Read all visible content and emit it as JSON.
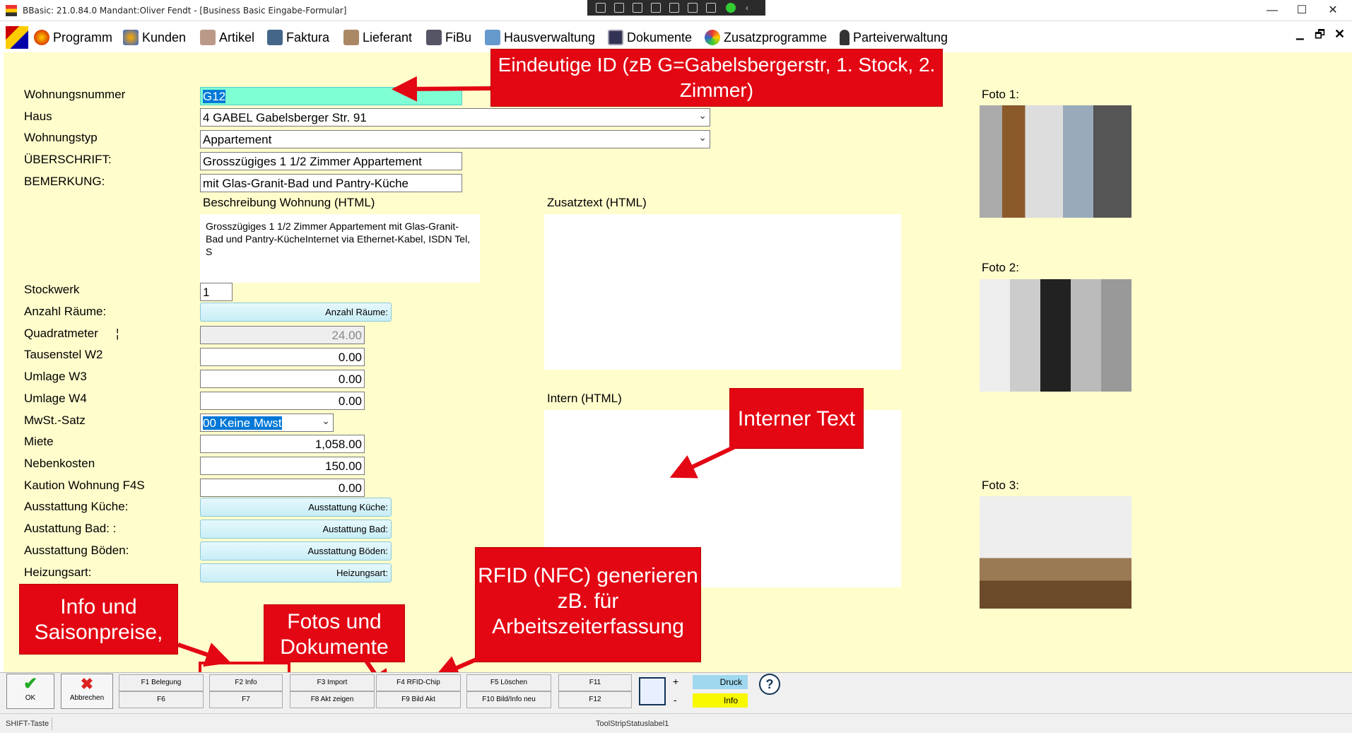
{
  "window": {
    "title": "BBasic: 21.0.84.0 Mandant:Oliver Fendt  - [Business Basic Eingabe-Formular]",
    "minimize": "—",
    "maximize": "☐",
    "close": "✕"
  },
  "menu": [
    "Programm",
    "Kunden",
    "Artikel",
    "Faktura",
    "Lieferant",
    "FiBu",
    "Hausverwaltung",
    "Dokumente",
    "Zusatzprogramme",
    "Parteiverwaltung"
  ],
  "mdi_controls": {
    "min": "▁",
    "restore": "🗗",
    "close": "✕"
  },
  "form": {
    "labels": {
      "wohnungsnummer": "Wohnungsnummer",
      "haus": "Haus",
      "wohnungstyp": "Wohnungstyp",
      "ueberschrift": "ÜBERSCHRIFT:",
      "bemerkung": "BEMERKUNG:",
      "stockwerk": "Stockwerk",
      "anzahl_raeume": "Anzahl Räume:",
      "quadratmeter": "Quadratmeter",
      "tausenstel": "Tausenstel W2",
      "umlage_w3": "Umlage W3",
      "umlage_w4": "Umlage W4",
      "mwst": "MwSt.-Satz",
      "miete": "Miete",
      "nebenkosten": "Nebenkosten",
      "kaution": "Kaution Wohnung F4S",
      "kueche": "Ausstattung Küche:",
      "bad": "Austattung Bad: :",
      "boeden": "Ausstattung Böden:",
      "heizung": "Heizungsart:"
    },
    "values": {
      "wohnungsnummer": "G12",
      "haus": "4 GABEL Gabelsberger Str. 91",
      "wohnungstyp": "Appartement",
      "ueberschrift": "Grosszügiges 1 1/2 Zimmer Appartement",
      "bemerkung": "mit Glas-Granit-Bad und Pantry-Küche",
      "stockwerk": "1",
      "quadratmeter": "24.00",
      "tausenstel": "0.00",
      "umlage_w3": "0.00",
      "umlage_w4": "0.00",
      "mwst": "00 Keine Mwst",
      "miete": "1,058.00",
      "nebenkosten": "150.00",
      "kaution": "0.00"
    },
    "buttons": {
      "anzahl_raeume": "Anzahl Räume:",
      "kueche": "Ausstattung Küche:",
      "bad": "Austattung Bad:",
      "boeden": "Ausstattung Böden:",
      "heizung": "Heizungsart:"
    },
    "quadratmeter_marker": "¦",
    "beschreibung_label": "Beschreibung Wohnung (HTML)",
    "beschreibung_text": "Grosszügiges 1 1/2 Zimmer Appartement mit Glas-Granit-Bad und Pantry-KücheInternet via Ethernet-Kabel, ISDN Tel, S",
    "zusatztext_label": "Zusatztext (HTML)",
    "intern_label": "Intern (HTML)",
    "fotos": [
      "Foto 1:",
      "Foto 2:",
      "Foto 3:"
    ]
  },
  "callouts": {
    "id": "Eindeutige ID (zB G=Gabelsbergerstr, 1. Stock, 2. Zimmer)",
    "intern": "Interner Text",
    "info": "Info und Saisonpreise,",
    "fotos": "Fotos und Dokumente",
    "rfid": "RFID (NFC) generieren zB. für Arbeitszeiterfassung"
  },
  "bottom": {
    "ok": "OK",
    "abbrechen": "Abbrechen",
    "fkeys_top": [
      "F1 Belegung",
      "F2 Info",
      "F3 Import",
      "F4 RFID-Chip",
      "F5 Löschen",
      "F11"
    ],
    "fkeys_bottom": [
      "F6",
      "F7",
      "F8 Akt zeigen",
      "F9 Bild Akt",
      "F10 Bild/Info neu",
      "F12"
    ],
    "plus": "+",
    "minus": "-",
    "druck": "Druck",
    "info": "Info"
  },
  "status": {
    "left": "SHIFT-Taste",
    "center": "ToolStripStatuslabel1"
  },
  "colors": {
    "form_bg": "#fffdcc",
    "callout": "#e30613",
    "highlight": "#7fffd4",
    "selection": "#0078d7"
  }
}
